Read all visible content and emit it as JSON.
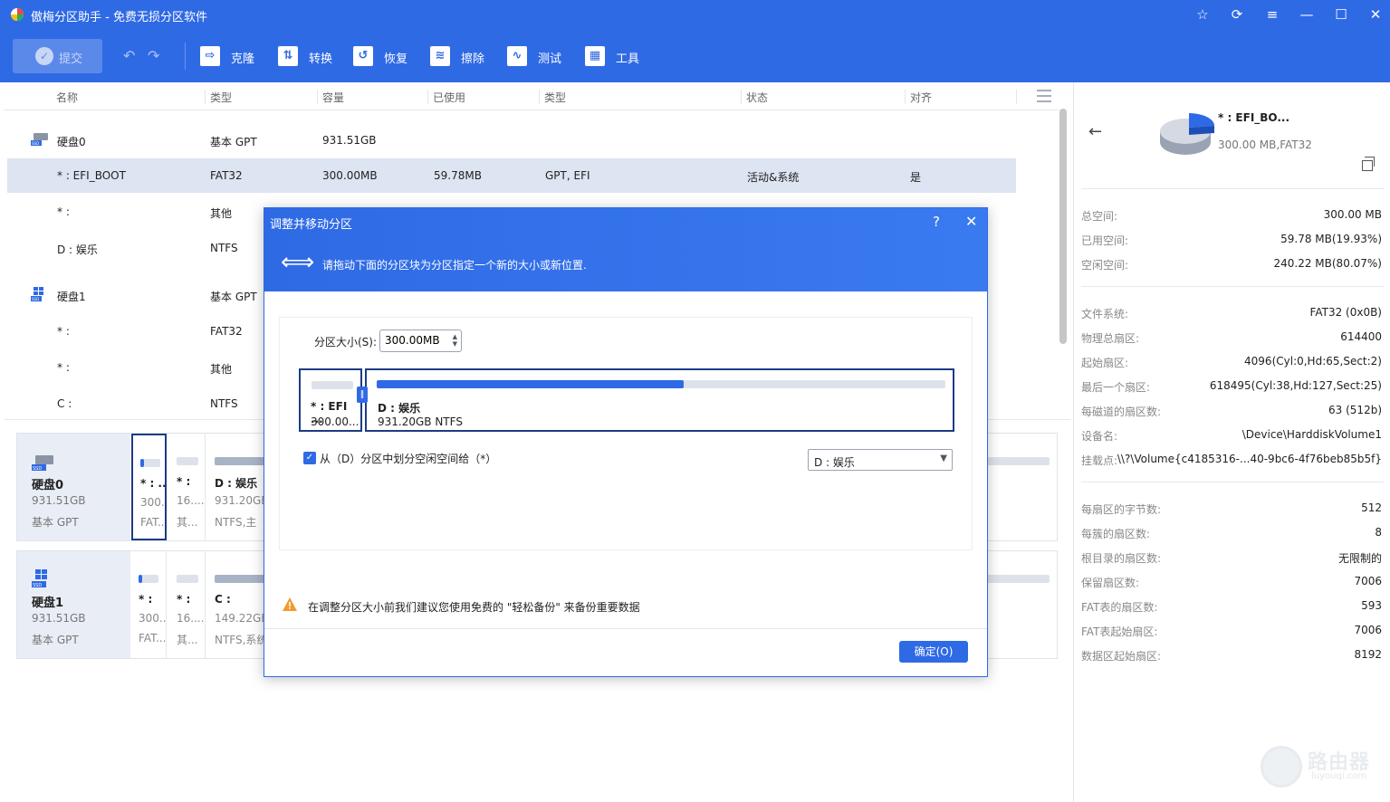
{
  "app": {
    "title": "傲梅分区助手 - 免费无损分区软件"
  },
  "toolbar": {
    "commit": "提交",
    "tools": [
      {
        "label": "克隆",
        "icon": "clone-icon"
      },
      {
        "label": "转换",
        "icon": "convert-icon"
      },
      {
        "label": "恢复",
        "icon": "restore-icon"
      },
      {
        "label": "擦除",
        "icon": "wipe-icon"
      },
      {
        "label": "测试",
        "icon": "test-icon"
      },
      {
        "label": "工具",
        "icon": "tools-icon"
      }
    ]
  },
  "table": {
    "headers": [
      "名称",
      "类型",
      "容量",
      "已使用",
      "类型",
      "状态",
      "对齐"
    ],
    "rows": [
      {
        "name": "硬盘0",
        "type": "基本 GPT",
        "cap": "931.51GB",
        "used": "",
        "ptype": "",
        "status": "",
        "align": ""
      },
      {
        "name": "* : EFI_BOOT",
        "type": "FAT32",
        "cap": "300.00MB",
        "used": "59.78MB",
        "ptype": "GPT, EFI",
        "status": "活动&系统",
        "align": "是"
      },
      {
        "name": "* :",
        "type": "其他",
        "cap": "",
        "used": "",
        "ptype": "",
        "status": "",
        "align": ""
      },
      {
        "name": "D : 娱乐",
        "type": "NTFS",
        "cap": "",
        "used": "",
        "ptype": "",
        "status": "",
        "align": ""
      },
      {
        "name": "硬盘1",
        "type": "基本 GPT",
        "cap": "",
        "used": "",
        "ptype": "",
        "status": "",
        "align": ""
      },
      {
        "name": "* :",
        "type": "FAT32",
        "cap": "",
        "used": "",
        "ptype": "",
        "status": "",
        "align": ""
      },
      {
        "name": "* :",
        "type": "其他",
        "cap": "",
        "used": "",
        "ptype": "",
        "status": "",
        "align": ""
      },
      {
        "name": "C :",
        "type": "NTFS",
        "cap": "",
        "used": "",
        "ptype": "",
        "status": "",
        "align": ""
      }
    ]
  },
  "disks": [
    {
      "name": "硬盘0",
      "size": "931.51GB",
      "type": "基本 GPT",
      "parts": [
        {
          "name": "* : ...",
          "size": "300...",
          "fs": "FAT...",
          "used_frac": 0.2
        },
        {
          "name": "* :",
          "size": "16....",
          "fs": "其...",
          "used_frac": 0
        },
        {
          "name": "D : 娱乐",
          "size": "931.20GB",
          "fs": "NTFS,主",
          "used_frac": 0
        }
      ]
    },
    {
      "name": "硬盘1",
      "size": "931.51GB",
      "type": "基本 GPT",
      "parts": [
        {
          "name": "* :",
          "size": "300...",
          "fs": "FAT...",
          "used_frac": 0.2
        },
        {
          "name": "* :",
          "size": "16....",
          "fs": "其...",
          "used_frac": 0
        },
        {
          "name": "C :",
          "size": "149.22GB",
          "fs": "NTFS,系统",
          "used_frac": 0
        }
      ]
    }
  ],
  "right_panel": {
    "name": "* : EFI_BO...",
    "sub": "300.00 MB,FAT32",
    "groups": [
      [
        {
          "k": "总空间:",
          "v": "300.00 MB"
        },
        {
          "k": "已用空间:",
          "v": "59.78 MB(19.93%)"
        },
        {
          "k": "空闲空间:",
          "v": "240.22 MB(80.07%)"
        }
      ],
      [
        {
          "k": "文件系统:",
          "v": "FAT32 (0x0B)"
        },
        {
          "k": "物理总扇区:",
          "v": "614400"
        },
        {
          "k": "起始扇区:",
          "v": "4096(Cyl:0,Hd:65,Sect:2)"
        },
        {
          "k": "最后一个扇区:",
          "v": "618495(Cyl:38,Hd:127,Sect:25)"
        },
        {
          "k": "每磁道的扇区数:",
          "v": "63 (512b)"
        },
        {
          "k": "设备名:",
          "v": "\\Device\\HarddiskVolume1"
        },
        {
          "k": "挂载点:",
          "v": "\\\\?\\Volume{c4185316-...40-9bc6-4f76beb85b5f}"
        }
      ],
      [
        {
          "k": "每扇区的字节数:",
          "v": "512"
        },
        {
          "k": "每簇的扇区数:",
          "v": "8"
        },
        {
          "k": "根目录的扇区数:",
          "v": "无限制的"
        },
        {
          "k": "保留扇区数:",
          "v": "7006"
        },
        {
          "k": "FAT表的扇区数:",
          "v": "593"
        },
        {
          "k": "FAT表起始扇区:",
          "v": "7006"
        },
        {
          "k": "数据区起始扇区:",
          "v": "8192"
        }
      ]
    ]
  },
  "dialog": {
    "title": "调整并移动分区",
    "help": "?",
    "desc": "请拖动下面的分区块为分区指定一个新的大小或新位置.",
    "size_label": "分区大小(S):",
    "size_value": "300.00MB",
    "efi_name": "* : EFI ...",
    "efi_size": "300.00...",
    "d_name": "D : 娱乐",
    "d_size": "931.20GB NTFS",
    "d_used_frac": 0.54,
    "checkbox_label": "从（D）分区中划分空闲空间给（*）",
    "select_value": "D : 娱乐",
    "warning": "在调整分区大小前我们建议您使用免费的 \"轻松备份\" 来备份重要数据",
    "ok": "确定(O)"
  },
  "watermark": {
    "title": "路由器",
    "sub": "luyouqi.com"
  }
}
